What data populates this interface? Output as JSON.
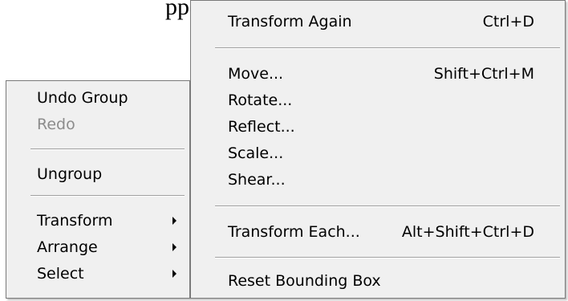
{
  "background": {
    "title_fragment": "pp"
  },
  "context_menu": {
    "items": [
      {
        "label": "Undo Group"
      },
      {
        "label": "Redo"
      },
      {
        "label": "Ungroup"
      },
      {
        "label": "Transform"
      },
      {
        "label": "Arrange"
      },
      {
        "label": "Select"
      }
    ]
  },
  "transform_submenu": {
    "items": [
      {
        "label": "Transform Again",
        "shortcut": "Ctrl+D"
      },
      {
        "label": "Move...",
        "shortcut": "Shift+Ctrl+M"
      },
      {
        "label": "Rotate..."
      },
      {
        "label": "Reflect..."
      },
      {
        "label": "Scale..."
      },
      {
        "label": "Shear..."
      },
      {
        "label": "Transform Each...",
        "shortcut": "Alt+Shift+Ctrl+D"
      },
      {
        "label": "Reset Bounding Box"
      }
    ]
  },
  "colors": {
    "menu_bg": "#f0f0f0",
    "disabled_text": "#8c8c8c",
    "border": "#7a7a7a"
  }
}
